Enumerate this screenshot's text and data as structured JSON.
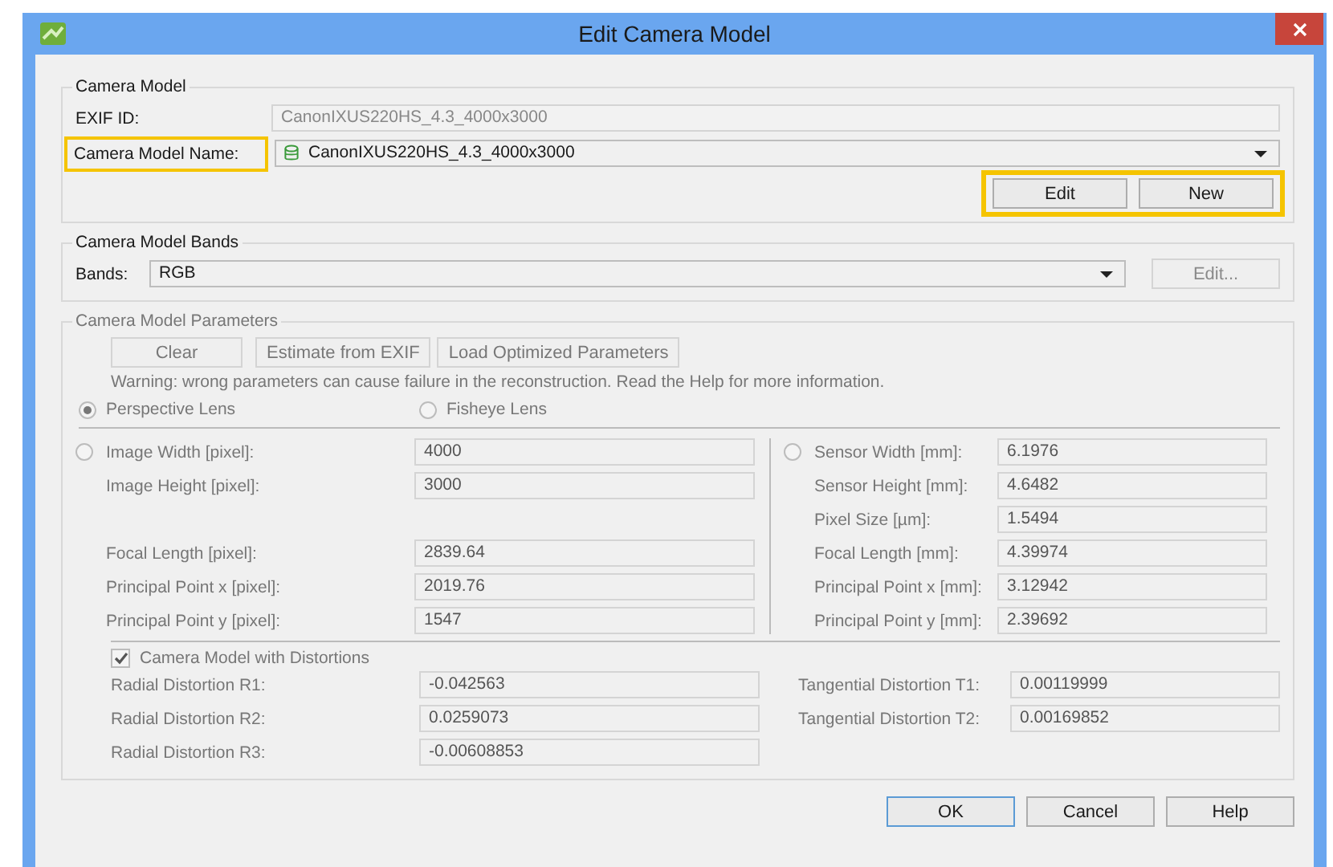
{
  "window": {
    "title": "Edit Camera Model"
  },
  "camera_model": {
    "title": "Camera Model",
    "exif_label": "EXIF ID:",
    "exif_value": "CanonIXUS220HS_4.3_4000x3000",
    "name_label": "Camera Model Name:",
    "name_label_highlighted": true,
    "name_value": "CanonIXUS220HS_4.3_4000x3000",
    "buttons": [
      "Edit",
      "New"
    ],
    "buttons_highlighted": true
  },
  "bands": {
    "title": "Camera Model Bands",
    "label": "Bands:",
    "value": "RGB",
    "edit_button": "Edit...",
    "edit_disabled": true
  },
  "parameters": {
    "title": "Camera Model Parameters",
    "disabled": true,
    "buttons": [
      "Clear",
      "Estimate from EXIF",
      "Load Optimized Parameters"
    ],
    "warning": "Warning: wrong parameters can cause failure in the reconstruction. Read the Help for more information.",
    "lens_options": [
      {
        "label": "Perspective Lens",
        "selected": true
      },
      {
        "label": "Fisheye Lens",
        "selected": false
      }
    ],
    "left": {
      "selected": false,
      "rows": [
        {
          "kind": "field",
          "label": "Image Width [pixel]:",
          "value": "4000"
        },
        {
          "kind": "field",
          "label": "Image Height [pixel]:",
          "value": "3000"
        },
        {
          "kind": "gap"
        },
        {
          "kind": "field",
          "label": "Focal Length [pixel]:",
          "value": "2839.64"
        },
        {
          "kind": "field",
          "label": "Principal Point x [pixel]:",
          "value": "2019.76"
        },
        {
          "kind": "field",
          "label": "Principal Point y [pixel]:",
          "value": "1547"
        }
      ]
    },
    "right": {
      "selected": false,
      "rows": [
        {
          "kind": "field",
          "label": "Sensor Width [mm]:",
          "value": "6.1976"
        },
        {
          "kind": "field",
          "label": "Sensor Height [mm]:",
          "value": "4.6482"
        },
        {
          "kind": "field",
          "label": "Pixel Size [µm]:",
          "value": "1.5494"
        },
        {
          "kind": "field",
          "label": "Focal Length [mm]:",
          "value": "4.39974"
        },
        {
          "kind": "field",
          "label": "Principal Point x [mm]:",
          "value": "3.12942"
        },
        {
          "kind": "field",
          "label": "Principal Point y [mm]:",
          "value": "2.39692"
        }
      ]
    },
    "distortions": {
      "label": "Camera Model with Distortions",
      "checked": true
    },
    "radial": [
      {
        "label": "Radial Distortion R1:",
        "value": "-0.042563"
      },
      {
        "label": "Radial Distortion R2:",
        "value": "0.0259073"
      },
      {
        "label": "Radial Distortion R3:",
        "value": "-0.00608853"
      }
    ],
    "tangential": [
      {
        "label": "Tangential Distortion T1:",
        "value": "0.00119999"
      },
      {
        "label": "Tangential Distortion T2:",
        "value": "0.00169852"
      }
    ]
  },
  "footer_buttons": [
    {
      "label": "OK",
      "default": true
    },
    {
      "label": "Cancel",
      "default": false
    },
    {
      "label": "Help",
      "default": false
    }
  ]
}
